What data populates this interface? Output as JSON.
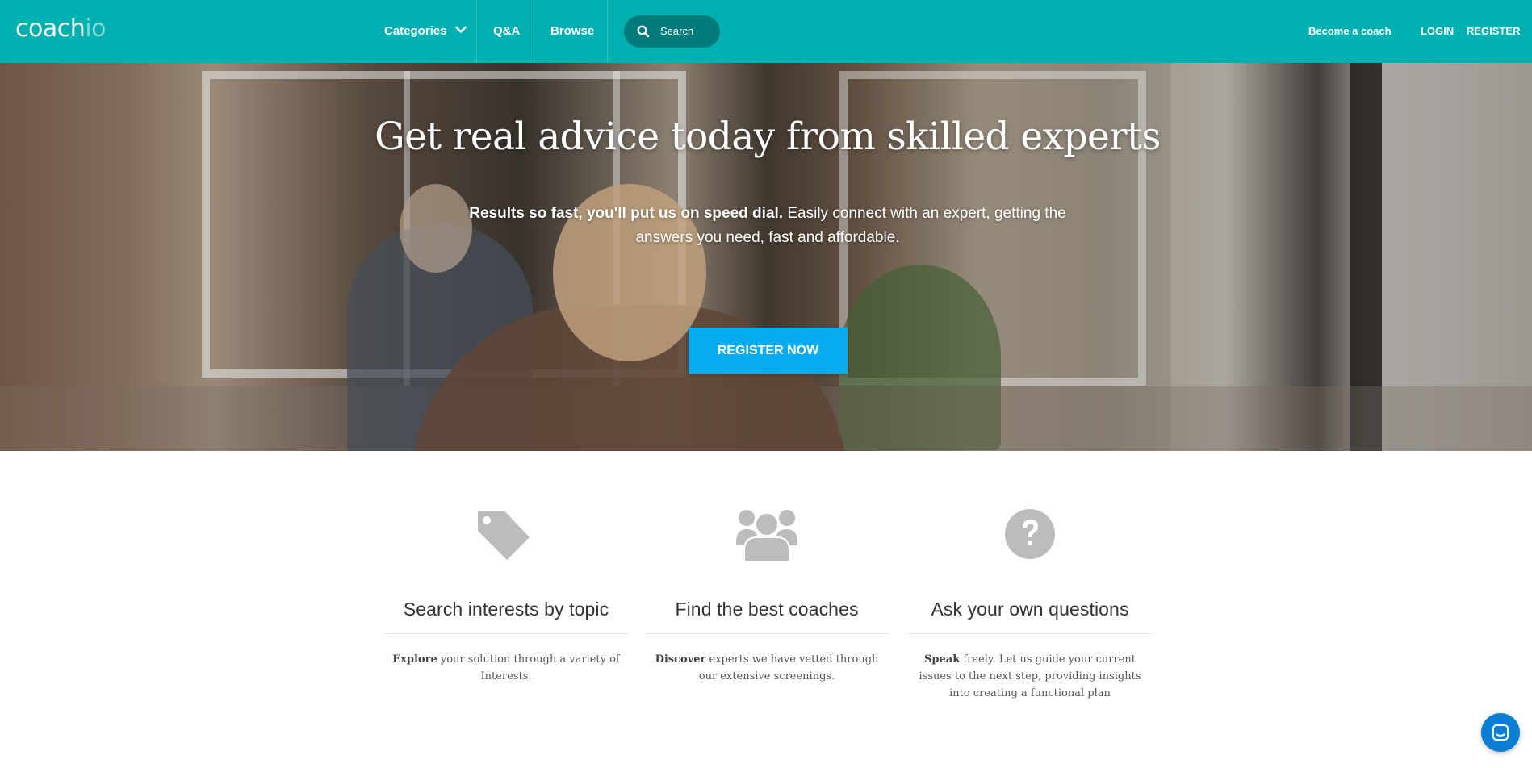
{
  "brand": {
    "logo_part1": "coach",
    "logo_part2": "io",
    "primary_color": "#00b0b0",
    "cta_color": "#0aacf0"
  },
  "nav": {
    "categories_label": "Categories",
    "qa_label": "Q&A",
    "browse_label": "Browse",
    "search_placeholder": "Search",
    "become_coach_label": "Become a coach",
    "login_label": "LOGIN",
    "register_label": "REGISTER"
  },
  "hero": {
    "title": "Get real advice today from skilled experts",
    "subtitle_bold": "Results so fast, you'll put us on speed dial.",
    "subtitle_rest": " Easily connect with an expert, getting the answers you need, fast and affordable.",
    "cta_label": "REGISTER NOW"
  },
  "features": [
    {
      "icon": "tags-icon",
      "title": "Search interests by topic",
      "desc_bold": "Explore",
      "desc_rest": " your solution through a variety of Interests."
    },
    {
      "icon": "users-icon",
      "title": "Find the best coaches",
      "desc_bold": "Discover",
      "desc_rest": " experts we have vetted through our extensive screenings."
    },
    {
      "icon": "question-circle-icon",
      "title": "Ask your own questions",
      "desc_bold": "Speak",
      "desc_rest": " freely. Let us guide your current issues to the next step, providing insights into creating a functional plan"
    }
  ],
  "chat": {
    "icon": "chat-icon"
  }
}
